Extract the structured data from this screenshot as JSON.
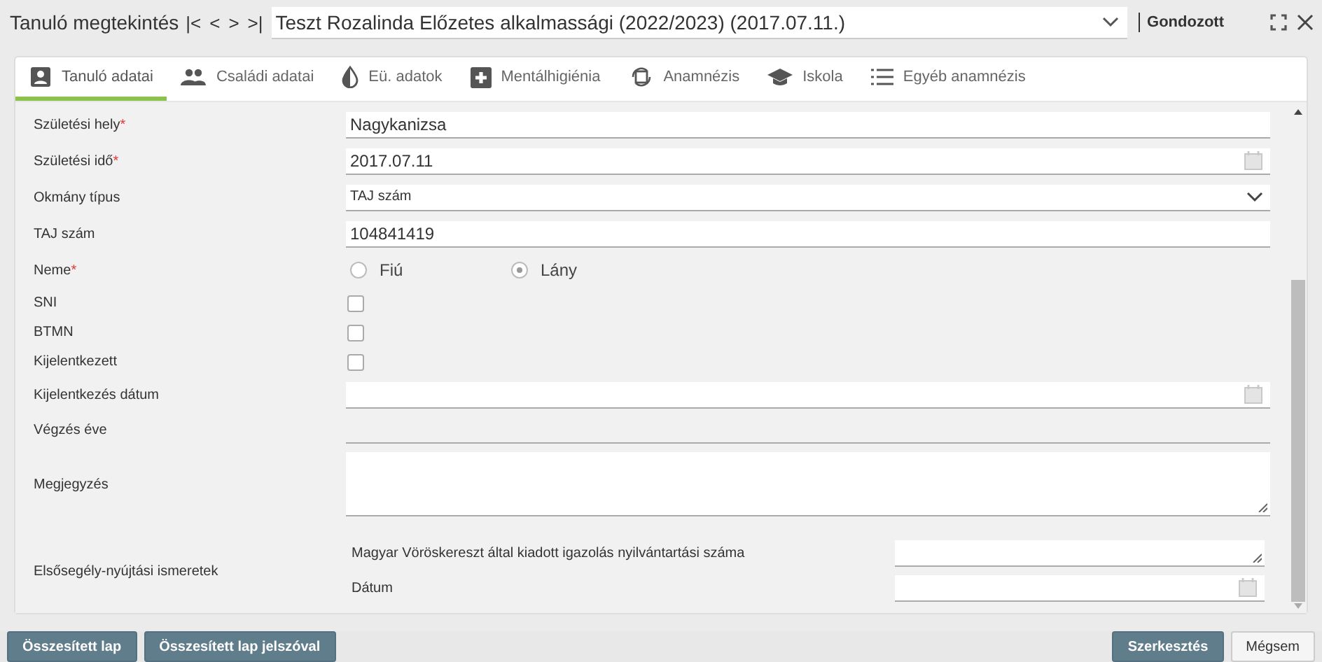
{
  "header": {
    "title": "Tanuló megtekintés",
    "nav": [
      "|<",
      "<",
      ">",
      ">|"
    ],
    "record": {
      "value": "Teszt Rozalinda Előzetes alkalmassági (2022/2023) (2017.07.11.)"
    },
    "status": "Gondozott"
  },
  "tabs": [
    {
      "label": "Tanuló adatai",
      "kind": "person",
      "selected": true
    },
    {
      "label": "Családi adatai",
      "kind": "people",
      "selected": false
    },
    {
      "label": "Eü. adatok",
      "kind": "drop",
      "selected": false
    },
    {
      "label": "Mentálhigiénia",
      "kind": "plus",
      "selected": false
    },
    {
      "label": "Anamnézis",
      "kind": "cycle",
      "selected": false
    },
    {
      "label": "Iskola",
      "kind": "cap",
      "selected": false
    },
    {
      "label": "Egyéb anamnézis",
      "kind": "list",
      "selected": false
    }
  ],
  "form": [
    {
      "kind": "text",
      "label": "Születési hely",
      "mark": "*",
      "value": "Nagykanizsa"
    },
    {
      "kind": "date",
      "label": "Születési idő",
      "mark": "*",
      "value": "2017.07.11"
    },
    {
      "kind": "select",
      "label": "Okmány típus",
      "value": "TAJ szám"
    },
    {
      "kind": "text",
      "label": "TAJ szám",
      "value": "104841419"
    },
    {
      "kind": "radio",
      "label": "Neme",
      "mark": "*",
      "options": [
        {
          "label": "Fiú",
          "selected": false
        },
        {
          "label": "Lány",
          "selected": true
        }
      ]
    },
    {
      "kind": "checkbox",
      "label": "SNI",
      "checked": false
    },
    {
      "kind": "checkbox",
      "label": "BTMN",
      "checked": false
    },
    {
      "kind": "checkbox",
      "label": "Kijelentkezett",
      "checked": false
    },
    {
      "kind": "date",
      "label": "Kijelentkezés dátum"
    },
    {
      "kind": "line",
      "label": "Végzés éve"
    },
    {
      "kind": "textarea",
      "label": "Megjegyzés"
    },
    {
      "kind": "group",
      "label": "Elsősegély-nyújtási ismeretek",
      "fields": [
        {
          "kind": "textarea",
          "label": "Magyar Vöröskereszt által kiadott igazolás nyilvántartási száma"
        },
        {
          "kind": "date",
          "label": "Dátum"
        }
      ]
    }
  ],
  "footer": {
    "left_buttons": [
      "Összesített lap",
      "Összesített lap jelszóval"
    ],
    "primary": "Szerkesztés",
    "cancel": "Mégsem"
  }
}
